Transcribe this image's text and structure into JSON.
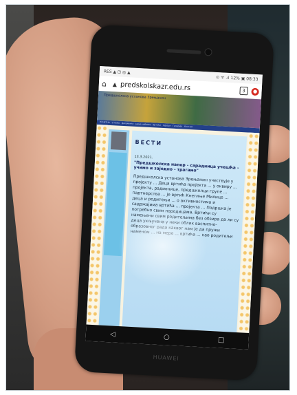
{
  "phone": {
    "brand": "HUAWEI",
    "status_bar": {
      "left": "RES ▲ ⊡ ◎ ▲",
      "right": "⊙ ᯤ .ıl 12% ▣ 08:33"
    },
    "browser": {
      "url": "predskolskazr.edu.rs",
      "tabs_count": "3"
    },
    "site": {
      "banner_title": "Предшколска установа Зрењанин",
      "nav": [
        "ПОЧЕТНА",
        "О нама",
        "Документа",
        "Јавне набавке",
        "Вртићи",
        "Одјеци",
        "Галерија",
        "Контакт"
      ],
      "heading": "ВЕСТИ",
      "news": {
        "date": "13.3.2021.",
        "title": "\"Предшколска напор - сарадница учешћа - учимо и заједно - трагамо\"",
        "body": "Предшколска установа Зрењанин учествује у пројекту ... Деца вртића пројекта ... у оквиру ... пројекта, радионице, предшколци групе ... партнерства ... је вртић Кнегиње Милице ... деца и родитељи ... о активностима и садржајима вртића ... пројекта ... Подршка је потребно свим породицама. Вртићи су намењени свим родитељима без обзира да ли су деца укључена у неки облик васпитно-образовног рада каквог нам је да пружи наменом ... на мере ... вртића ... као родитељи"
      }
    }
  }
}
